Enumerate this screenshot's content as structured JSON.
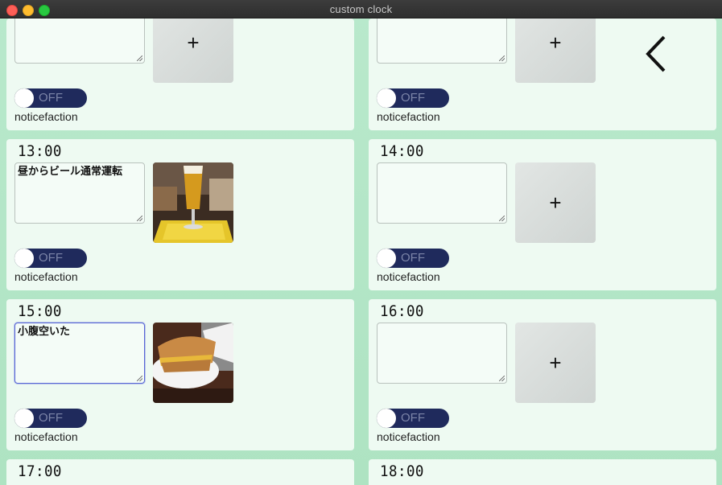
{
  "window": {
    "title": "custom clock"
  },
  "icons": {
    "add": "+",
    "back": "chevron-left-icon"
  },
  "toggle_label": "OFF",
  "notice_label": "noticefaction",
  "slots": [
    {
      "time": "",
      "memo": "",
      "has_photo": false,
      "toggle": "OFF"
    },
    {
      "time": "",
      "memo": "",
      "has_photo": false,
      "toggle": "OFF"
    },
    {
      "time": "13:00",
      "memo": "昼からビール通常運転",
      "has_photo": true,
      "photo": "beer-glass",
      "toggle": "OFF"
    },
    {
      "time": "14:00",
      "memo": "",
      "has_photo": false,
      "toggle": "OFF"
    },
    {
      "time": "15:00",
      "memo": "小腹空いた",
      "has_photo": true,
      "photo": "sandwich",
      "toggle": "OFF"
    },
    {
      "time": "16:00",
      "memo": "",
      "has_photo": false,
      "toggle": "OFF"
    },
    {
      "time": "17:00"
    },
    {
      "time": "18:00"
    }
  ]
}
